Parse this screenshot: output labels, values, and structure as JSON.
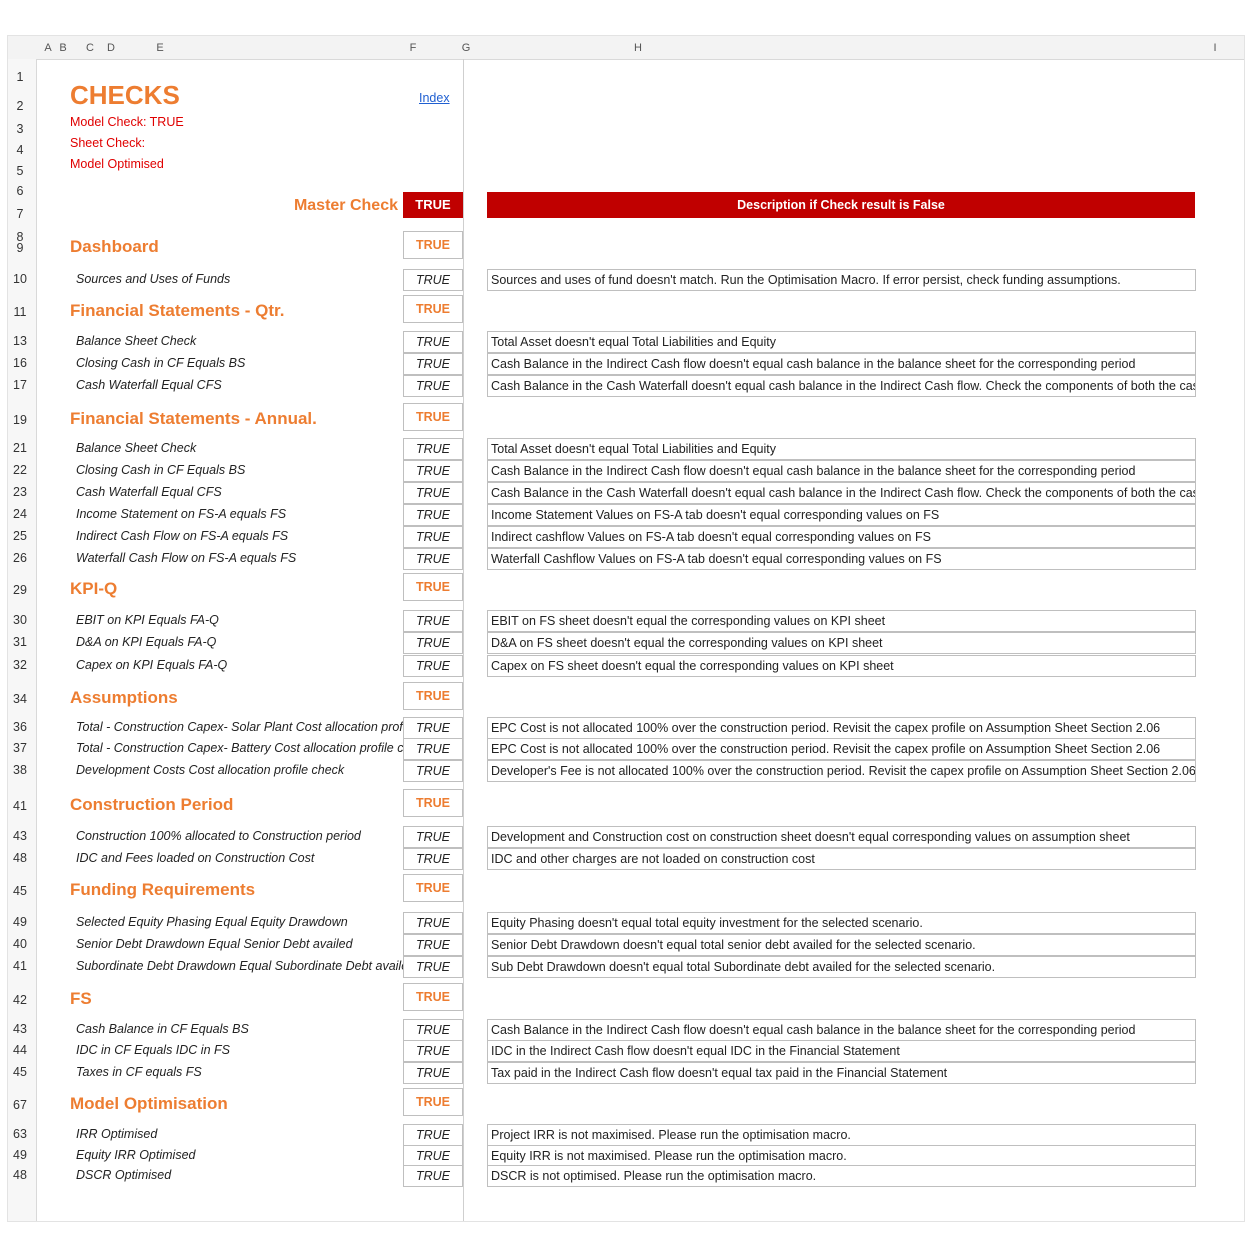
{
  "columns": [
    "A",
    "B",
    "C",
    "D",
    "E",
    "F",
    "G",
    "H",
    "I"
  ],
  "header": {
    "title": "CHECKS",
    "model_check": "Model Check: TRUE",
    "sheet_check": "Sheet Check:",
    "model_optimised": "Model Optimised",
    "index_link": "Index"
  },
  "master": {
    "label": "Master Check",
    "value": "TRUE"
  },
  "desc_header": "Description if Check result is False",
  "top_rows": [
    "1",
    "2",
    "3",
    "4",
    "5",
    "6",
    "7",
    "8"
  ],
  "sections": [
    {
      "row": "9",
      "title": "Dashboard",
      "value": "TRUE",
      "items": [
        {
          "row": "10",
          "label": "Sources and Uses of Funds",
          "value": "TRUE",
          "desc": "Sources and uses of fund doesn't match. Run the Optimisation Macro. If error persist, check funding assumptions."
        }
      ]
    },
    {
      "row": "11",
      "title": "Financial Statements - Qtr.",
      "value": "TRUE",
      "items": [
        {
          "row": "13",
          "label": "Balance Sheet Check",
          "value": "TRUE",
          "desc": "Total Asset doesn't equal Total Liabilities and Equity"
        },
        {
          "row": "16",
          "label": "Closing Cash in CF Equals BS",
          "value": "TRUE",
          "desc": "Cash Balance in the Indirect Cash flow doesn't equal cash balance in the balance sheet for the corresponding period"
        },
        {
          "row": "17",
          "label": "Cash Waterfall Equal CFS",
          "value": "TRUE",
          "desc": "Cash Balance in the Cash Waterfall doesn't equal cash balance in the Indirect Cash flow. Check the components of both the cash flows"
        }
      ]
    },
    {
      "row": "19",
      "title": "Financial Statements - Annual.",
      "value": "TRUE",
      "items": [
        {
          "row": "21",
          "label": "Balance Sheet Check",
          "value": "TRUE",
          "desc": "Total Asset doesn't equal Total Liabilities and Equity"
        },
        {
          "row": "22",
          "label": "Closing Cash in CF Equals BS",
          "value": "TRUE",
          "desc": "Cash Balance in the Indirect Cash flow doesn't equal cash balance in the balance sheet for the corresponding period"
        },
        {
          "row": "23",
          "label": "Cash Waterfall Equal CFS",
          "value": "TRUE",
          "desc": "Cash Balance in the Cash Waterfall doesn't equal cash balance in the Indirect Cash flow. Check the components of both the cash flows"
        },
        {
          "row": "24",
          "label": "Income Statement on FS-A equals FS",
          "value": "TRUE",
          "desc": "Income Statement Values on FS-A tab doesn't equal corresponding values on FS"
        },
        {
          "row": "25",
          "label": "Indirect Cash Flow on FS-A equals FS",
          "value": "TRUE",
          "desc": "Indirect cashflow Values on FS-A tab doesn't equal corresponding values on FS"
        },
        {
          "row": "26",
          "label": "Waterfall Cash Flow on FS-A equals FS",
          "value": "TRUE",
          "desc": "Waterfall Cashflow Values on FS-A tab doesn't equal corresponding values on FS"
        }
      ]
    },
    {
      "row": "29",
      "title": "KPI-Q",
      "value": "TRUE",
      "items": [
        {
          "row": "30",
          "label": "EBIT on KPI Equals FA-Q",
          "value": "TRUE",
          "desc": "EBIT on FS sheet doesn't equal the corresponding values on KPI sheet"
        },
        {
          "row": "31",
          "label": "D&A on KPI Equals FA-Q",
          "value": "TRUE",
          "desc": "D&A on FS sheet doesn't equal the corresponding values on KPI sheet"
        },
        {
          "row": "32",
          "label": "Capex on KPI Equals FA-Q",
          "value": "TRUE",
          "desc": "Capex on FS sheet doesn't equal the corresponding values on KPI sheet"
        }
      ]
    },
    {
      "row": "34",
      "title": "Assumptions",
      "value": "TRUE",
      "items": [
        {
          "row": "36",
          "label": "Total - Construction Capex- Solar Plant Cost allocation profile check",
          "value": "TRUE",
          "desc": "EPC Cost is not allocated 100% over the construction period. Revisit the capex profile on Assumption Sheet Section 2.06"
        },
        {
          "row": "37",
          "label": "Total - Construction Capex- Battery Cost allocation profile check",
          "value": "TRUE",
          "desc": "EPC Cost is not allocated 100% over the construction period. Revisit the capex profile on Assumption Sheet Section 2.06"
        },
        {
          "row": "38",
          "label": "Development Costs Cost allocation profile check",
          "value": "TRUE",
          "desc": "Developer's Fee is not allocated 100% over the construction period. Revisit the capex profile on Assumption Sheet Section 2.06"
        }
      ]
    },
    {
      "row": "41",
      "title": "Construction Period",
      "value": "TRUE",
      "items": [
        {
          "row": "43",
          "label": "Construction 100% allocated to Construction period",
          "value": "TRUE",
          "desc": "Development and Construction cost on construction sheet doesn't equal corresponding values on assumption sheet"
        },
        {
          "row": "48",
          "label": "IDC and Fees loaded on Construction Cost",
          "value": "TRUE",
          "desc": "IDC and other charges are not loaded on construction cost"
        }
      ]
    },
    {
      "row": "45",
      "title": "Funding Requirements",
      "value": "TRUE",
      "items": [
        {
          "row": "49",
          "label": "Selected Equity Phasing Equal Equity Drawdown",
          "value": "TRUE",
          "desc": "Equity Phasing doesn't equal total equity investment for the selected scenario."
        },
        {
          "row": "40",
          "label": "Senior Debt Drawdown Equal Senior Debt availed",
          "value": "TRUE",
          "desc": "Senior Debt Drawdown doesn't equal total senior debt availed for the selected scenario."
        },
        {
          "row": "41",
          "label": "Subordinate Debt Drawdown Equal Subordinate Debt availed",
          "value": "TRUE",
          "desc": "Sub Debt Drawdown doesn't equal total Subordinate debt availed for the selected scenario."
        }
      ]
    },
    {
      "row": "42",
      "title": "FS",
      "value": "TRUE",
      "items": [
        {
          "row": "43",
          "label": "Cash Balance in CF Equals BS",
          "value": "TRUE",
          "desc": "Cash Balance in the Indirect Cash flow doesn't equal cash balance in the balance sheet for the corresponding period"
        },
        {
          "row": "44",
          "label": "IDC in CF Equals IDC in FS",
          "value": "TRUE",
          "desc": "IDC in the Indirect Cash flow doesn't equal IDC in the Financial Statement"
        },
        {
          "row": "45",
          "label": "Taxes in CF equals FS",
          "value": "TRUE",
          "desc": "Tax paid in the Indirect Cash flow doesn't equal tax paid in the Financial Statement"
        }
      ]
    },
    {
      "row": "67",
      "title": "Model Optimisation",
      "value": "TRUE",
      "items": [
        {
          "row": "63",
          "label": "IRR Optimised",
          "value": "TRUE",
          "desc": "Project IRR is not maximised. Please run the optimisation macro."
        },
        {
          "row": "49",
          "label": "Equity IRR Optimised",
          "value": "TRUE",
          "desc": "Equity IRR is not maximised. Please run the optimisation macro."
        },
        {
          "row": "48",
          "label": "DSCR Optimised",
          "value": "TRUE",
          "desc": "DSCR is not optimised. Please run the optimisation macro."
        }
      ]
    }
  ]
}
